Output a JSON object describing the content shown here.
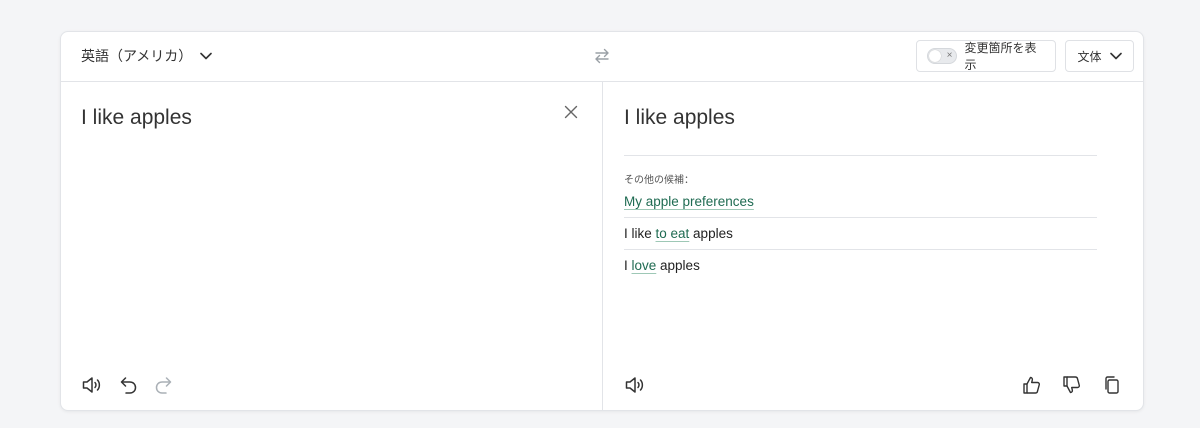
{
  "header": {
    "source_language": "英語（アメリカ）",
    "show_changes_label": "変更箇所を表示",
    "toggle_state_symbol": "×",
    "style_label": "文体"
  },
  "source": {
    "text": "I like apples"
  },
  "target": {
    "text": "I like apples",
    "alternatives_heading": "その他の候補：",
    "alternatives": [
      {
        "parts": [
          {
            "text": "My apple preferences",
            "highlight": true
          }
        ]
      },
      {
        "parts": [
          {
            "text": "I like ",
            "highlight": false
          },
          {
            "text": "to eat",
            "highlight": true
          },
          {
            "text": " apples",
            "highlight": false
          }
        ]
      },
      {
        "parts": [
          {
            "text": "I ",
            "highlight": false
          },
          {
            "text": "love",
            "highlight": true
          },
          {
            "text": " apples",
            "highlight": false
          }
        ]
      }
    ]
  },
  "colors": {
    "accent_green": "#1f6b52",
    "underline_green": "#9ec8b6",
    "border": "#e2e4e8",
    "background": "#f4f5f7"
  },
  "icons": {
    "source_tools": [
      "speaker-icon",
      "undo-icon",
      "redo-icon"
    ],
    "target_tools_left": [
      "speaker-icon"
    ],
    "target_tools_right": [
      "thumbs-up-icon",
      "thumbs-down-icon",
      "copy-icon"
    ]
  }
}
